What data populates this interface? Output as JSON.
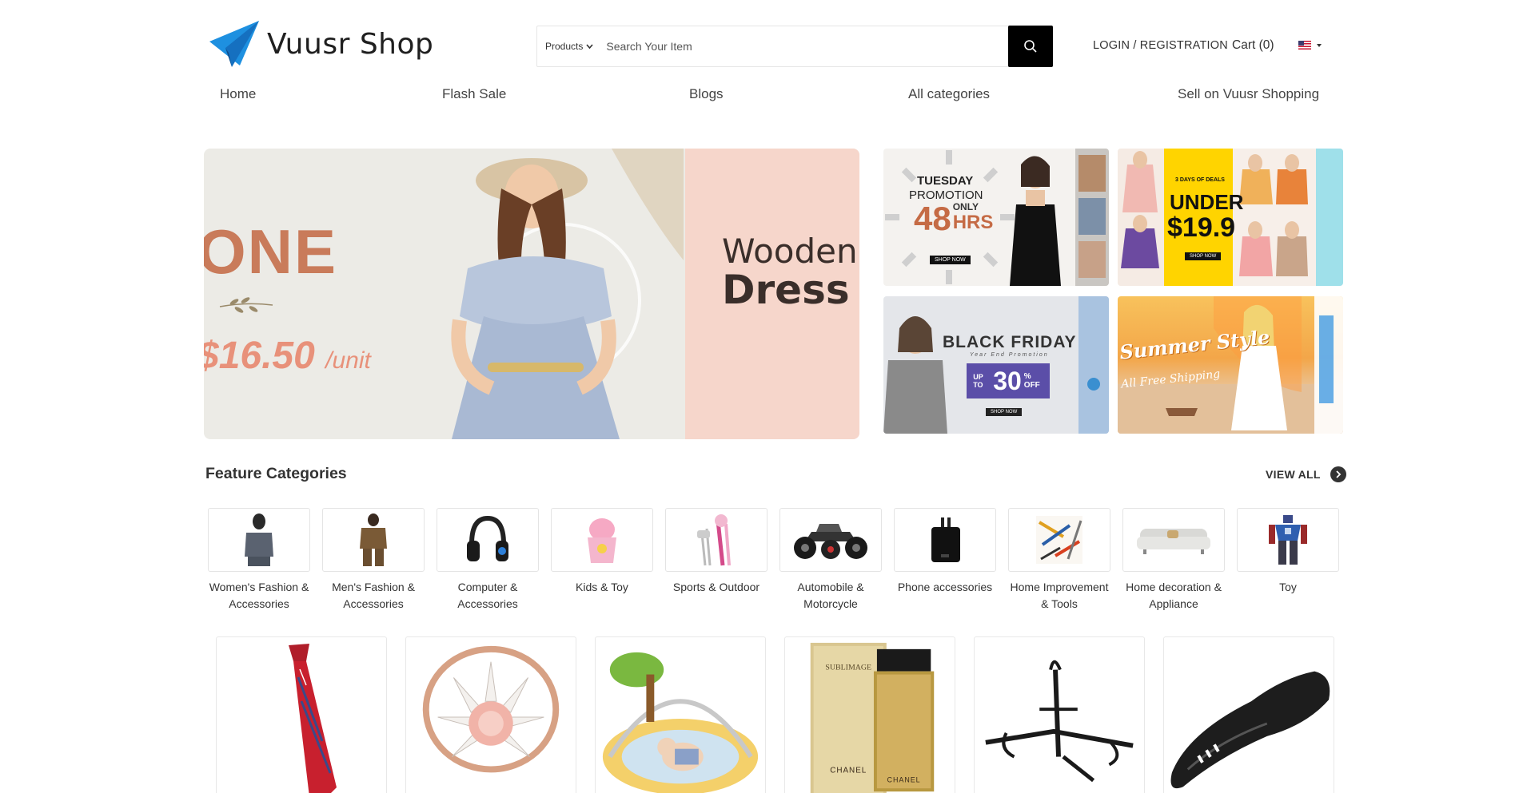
{
  "brand": {
    "name": "Vuusr Shop"
  },
  "search": {
    "category": "Products",
    "placeholder": "Search Your Item"
  },
  "account": {
    "login_label": "LOGIN / REGISTRATION",
    "cart_label": "Cart (0)"
  },
  "nav": [
    "Home",
    "Flash Sale",
    "Blogs",
    "All categories",
    "Sell on Vuusr Shopping"
  ],
  "hero": {
    "word": "ONE",
    "price": "$16.50",
    "unit": "/unit",
    "title_line1": "Wooden",
    "title_line2": "Dress"
  },
  "promos": [
    {
      "line1": "TUESDAY",
      "line2": "PROMOTION",
      "big": "48",
      "big_suffix": "ONLY",
      "big2": "HRS",
      "cta": "SHOP NOW"
    },
    {
      "line1": "3 DAYS OF DEALS",
      "line2": "UNDER",
      "big": "$19.9",
      "cta": "SHOP NOW"
    },
    {
      "line1": "BLACK FRIDAY",
      "line2": "Year End Promotion",
      "small": "UP TO",
      "big": "30",
      "suffix": "% OFF",
      "cta": "SHOP NOW"
    },
    {
      "line1": "Summer Style",
      "line2": "All Free Shipping"
    }
  ],
  "features": {
    "title": "Feature Categories",
    "view_all": "VIEW ALL",
    "categories": [
      {
        "label": "Women's Fashion & Accessories",
        "icon": "women-fashion-icon"
      },
      {
        "label": "Men's Fashion & Accessories",
        "icon": "men-fashion-icon"
      },
      {
        "label": "Computer & Accessories",
        "icon": "headphones-icon"
      },
      {
        "label": "Kids & Toy",
        "icon": "kids-toy-icon"
      },
      {
        "label": "Sports & Outdoor",
        "icon": "golf-clubs-icon"
      },
      {
        "label": "Automobile & Motorcycle",
        "icon": "atv-icon"
      },
      {
        "label": "Phone accessories",
        "icon": "charger-icon"
      },
      {
        "label": "Home Improvement & Tools",
        "icon": "tools-icon"
      },
      {
        "label": "Home decoration & Appliance",
        "icon": "sofa-icon"
      },
      {
        "label": "Toy",
        "icon": "robot-toy-icon"
      }
    ]
  },
  "products": [
    {
      "name": "Necktie",
      "icon": "necktie-icon"
    },
    {
      "name": "Ring",
      "icon": "ring-icon"
    },
    {
      "name": "Baby play gym",
      "icon": "play-gym-icon"
    },
    {
      "name": "Perfume",
      "icon": "perfume-icon",
      "box_text": "SUBLIMAGE",
      "brand": "CHANEL"
    },
    {
      "name": "Bike rack",
      "icon": "bike-rack-icon"
    },
    {
      "name": "Bike saddle",
      "icon": "bike-saddle-icon"
    }
  ],
  "colors": {
    "accent": "#1e90e0",
    "button_dark": "#000000",
    "text": "#333333",
    "border": "#e4e4e4"
  }
}
